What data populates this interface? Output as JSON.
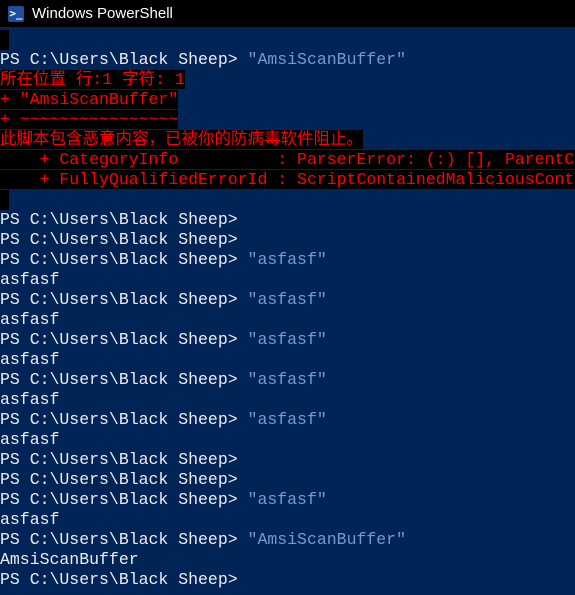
{
  "window": {
    "title": "Windows PowerShell",
    "icon": "powershell-icon"
  },
  "colors": {
    "background": "#012456",
    "text": "#eeedf0",
    "string": "#6e9dd4",
    "error": "#ff0000",
    "error_background": "#000000"
  },
  "console": {
    "prompt": "PS C:\\Users\\Black Sheep>",
    "cmd1": "\"AmsiScanBuffer\"",
    "err_pos": "所在位置 行:1 字符: 1",
    "err_echo": "+ \"AmsiScanBuffer\"",
    "err_squiggle": "+ ~~~~~~~~~~~~~~~~",
    "err_msg": "此脚本包含恶意内容，已被你的防病毒软件阻止。",
    "err_cat": "    + CategoryInfo          : ParserError: (:) [], ParentContainsErrorRecordException",
    "err_fqid": "    + FullyQualifiedErrorId : ScriptContainedMaliciousContent",
    "cmd_asf": "\"asfasf\"",
    "out_asf": "asfasf",
    "cmd_amsi": "\"AmsiScanBuffer\"",
    "out_amsi": "AmsiScanBuffer"
  }
}
